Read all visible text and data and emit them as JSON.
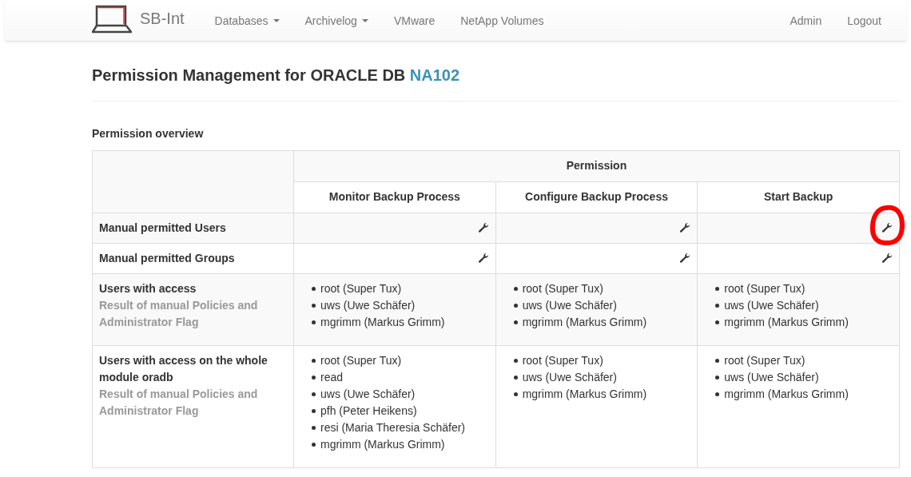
{
  "navbar": {
    "brand": "SB-Int",
    "items": [
      {
        "label": "Databases",
        "dropdown": true
      },
      {
        "label": "Archivelog",
        "dropdown": true
      },
      {
        "label": "VMware",
        "dropdown": false
      },
      {
        "label": "NetApp Volumes",
        "dropdown": false
      }
    ],
    "right_items": [
      "Admin",
      "Logout"
    ]
  },
  "page": {
    "title": "Permission Management for ORACLE DB",
    "title_link": "NA102",
    "section": "Permission overview"
  },
  "table": {
    "group_header": "Permission",
    "columns": [
      "Monitor Backup Process",
      "Configure Backup Process",
      "Start Backup"
    ],
    "rows": [
      {
        "kind": "edit",
        "label": "Manual permitted Users",
        "cells": [
          {
            "highlighted": false
          },
          {
            "highlighted": false
          },
          {
            "highlighted": true
          }
        ]
      },
      {
        "kind": "edit",
        "label": "Manual permitted Groups",
        "cells": [
          {
            "highlighted": false
          },
          {
            "highlighted": false
          },
          {
            "highlighted": false
          }
        ]
      },
      {
        "kind": "list",
        "label": "Users with access",
        "note": "Result of manual Policies and Administrator Flag",
        "cells": [
          [
            "root (Super Tux)",
            "uws (Uwe Schäfer)",
            "mgrimm (Markus Grimm)"
          ],
          [
            "root (Super Tux)",
            "uws (Uwe Schäfer)",
            "mgrimm (Markus Grimm)"
          ],
          [
            "root (Super Tux)",
            "uws (Uwe Schäfer)",
            "mgrimm (Markus Grimm)"
          ]
        ]
      },
      {
        "kind": "list",
        "label": "Users with access on the whole module oradb",
        "note": "Result of manual Policies and Administrator Flag",
        "cells": [
          [
            "root (Super Tux)",
            "read",
            "uws (Uwe Schäfer)",
            "pfh (Peter Heikens)",
            "resi (Maria Theresia Schäfer)",
            "mgrimm (Markus Grimm)"
          ],
          [
            "root (Super Tux)",
            "uws (Uwe Schäfer)",
            "mgrimm (Markus Grimm)"
          ],
          [
            "root (Super Tux)",
            "uws (Uwe Schäfer)",
            "mgrimm (Markus Grimm)"
          ]
        ]
      }
    ]
  }
}
